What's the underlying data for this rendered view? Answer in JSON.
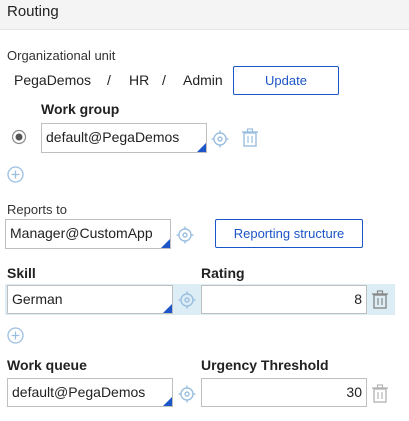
{
  "header": {
    "title": "Routing"
  },
  "org": {
    "label": "Organizational unit",
    "parts": [
      "PegaDemos",
      "/",
      "HR",
      "/",
      "Admin"
    ],
    "update_label": "Update"
  },
  "workgroup": {
    "label": "Work group",
    "value": "default@PegaDemos"
  },
  "reports": {
    "label": "Reports to",
    "value": "Manager@CustomApp",
    "button_label": "Reporting structure"
  },
  "skills": {
    "skill_header": "Skill",
    "rating_header": "Rating",
    "rows": [
      {
        "skill": "German",
        "rating": "8"
      }
    ]
  },
  "queues": {
    "queue_header": "Work queue",
    "urgency_header": "Urgency Threshold",
    "rows": [
      {
        "queue": "default@PegaDemos",
        "urgency": "30"
      }
    ]
  },
  "colors": {
    "accent": "#1b55c7",
    "icon": "#9bbfe0",
    "highlight": "#dcedf6"
  },
  "icons": [
    "radio-icon",
    "target-icon",
    "trash-icon",
    "add-icon"
  ]
}
